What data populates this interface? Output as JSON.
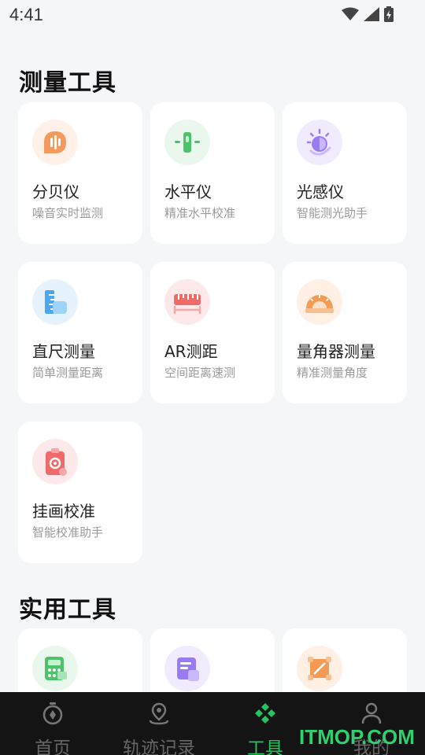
{
  "status_bar": {
    "time": "4:41",
    "icons": [
      "wifi-icon",
      "signal-icon",
      "battery-icon"
    ]
  },
  "sections": {
    "measure": {
      "title": "测量工具"
    },
    "utility": {
      "title": "实用工具"
    }
  },
  "measure_tools": [
    {
      "title": "分贝仪",
      "subtitle": "噪音实时监测",
      "icon": "decibel-meter-icon",
      "color": "#f39a5c"
    },
    {
      "title": "水平仪",
      "subtitle": "精准水平校准",
      "icon": "level-icon",
      "color": "#4cc36b"
    },
    {
      "title": "光感仪",
      "subtitle": "智能测光助手",
      "icon": "light-sensor-icon",
      "color": "#9b7cf0"
    },
    {
      "title": "直尺测量",
      "subtitle": "简单测量距离",
      "icon": "ruler-icon",
      "color": "#4aa8f0"
    },
    {
      "title": "AR测距",
      "subtitle": "空间距离速测",
      "icon": "ar-distance-icon",
      "color": "#f06a6a"
    },
    {
      "title": "量角器测量",
      "subtitle": "精准测量角度",
      "icon": "protractor-icon",
      "color": "#f59a52"
    },
    {
      "title": "挂画校准",
      "subtitle": "智能校准助手",
      "icon": "picture-calibration-icon",
      "color": "#f06a6a"
    }
  ],
  "utility_tools": [
    {
      "icon": "calculator-icon",
      "color": "#4cc36b"
    },
    {
      "icon": "calendar-icon",
      "color": "#9b7cf0"
    },
    {
      "icon": "crop-icon",
      "color": "#f59a52"
    }
  ],
  "bottom_nav": [
    {
      "label": "首页",
      "icon": "home-compass-icon",
      "active": false
    },
    {
      "label": "轨迹记录",
      "icon": "location-pin-icon",
      "active": false
    },
    {
      "label": "工具",
      "icon": "tools-grid-icon",
      "active": true
    },
    {
      "label": "我的",
      "icon": "profile-icon",
      "active": false
    }
  ],
  "watermark": {
    "text": "ITMOP.COM",
    "color": "#2fd16f"
  },
  "colors": {
    "background": "#f5f6f8",
    "nav_background": "#141414",
    "accent": "#22c55e"
  }
}
